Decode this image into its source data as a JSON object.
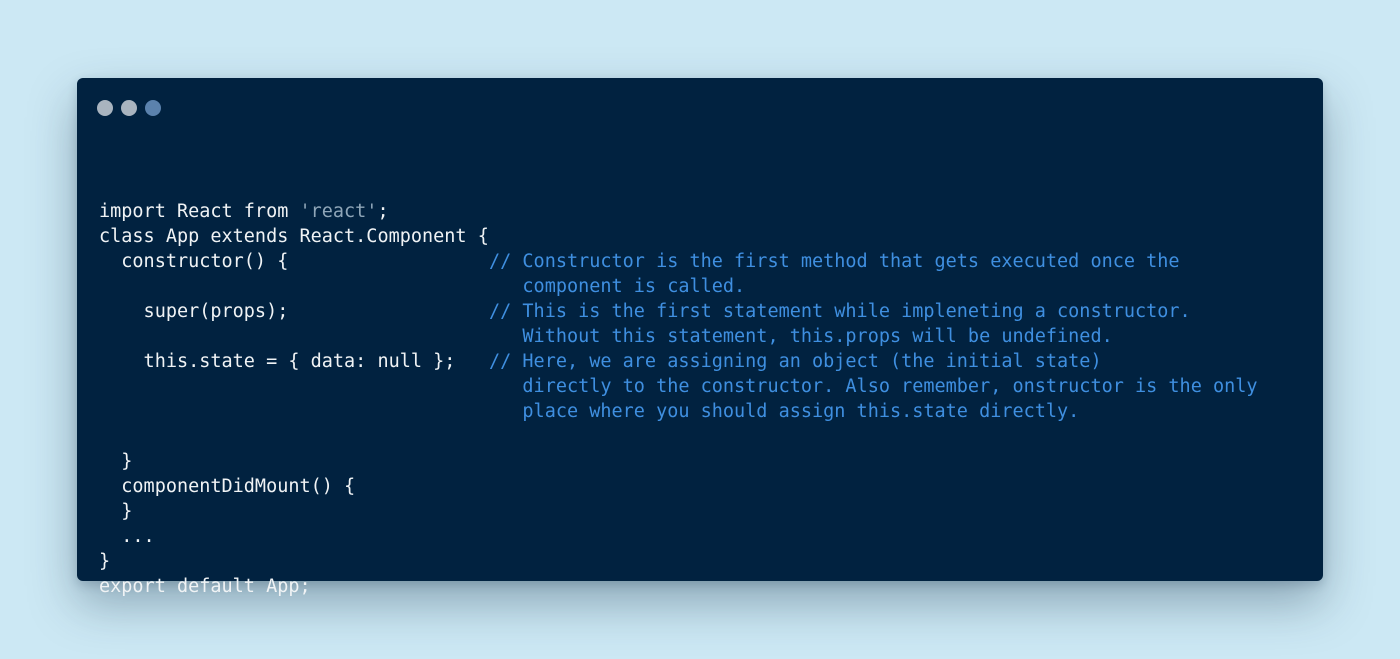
{
  "window": {
    "controls": [
      {
        "name": "close",
        "color": "#a9b4bf"
      },
      {
        "name": "minimize",
        "color": "#a9b4bf"
      },
      {
        "name": "maximize",
        "color": "#5b82ad"
      }
    ]
  },
  "code": {
    "lines": [
      {
        "code": "",
        "comment": ""
      },
      {
        "code": "import React from ",
        "string": "'react'",
        "after": ";",
        "comment": ""
      },
      {
        "code": "class App extends React.Component {",
        "comment": ""
      },
      {
        "code": "  constructor() {",
        "comment": "// Constructor is the first method that gets executed once the"
      },
      {
        "code": "",
        "comment": "   component is called."
      },
      {
        "code": "    super(props);",
        "comment": "// This is the first statement while impleneting a constructor."
      },
      {
        "code": "",
        "comment": "   Without this statement, this.props will be undefined."
      },
      {
        "code": "    this.state = { data: null };",
        "comment": "// Here, we are assigning an object (the initial state)"
      },
      {
        "code": "",
        "comment": "   directly to the constructor. Also remember, onstructor is the only"
      },
      {
        "code": "",
        "comment": "   place where you should assign this.state directly."
      },
      {
        "code": "",
        "comment": ""
      },
      {
        "code": "  }",
        "comment": ""
      },
      {
        "code": "  componentDidMount() {",
        "comment": ""
      },
      {
        "code": "  }",
        "comment": ""
      },
      {
        "code": "  ...",
        "comment": ""
      },
      {
        "code": "}",
        "comment": ""
      },
      {
        "code": "export default App;",
        "comment": ""
      }
    ]
  },
  "colors": {
    "background": "#cce8f4",
    "window": "#012240",
    "code_text": "#f0f3f5",
    "string": "#8fa6b8",
    "comment": "#3f8fe0"
  }
}
